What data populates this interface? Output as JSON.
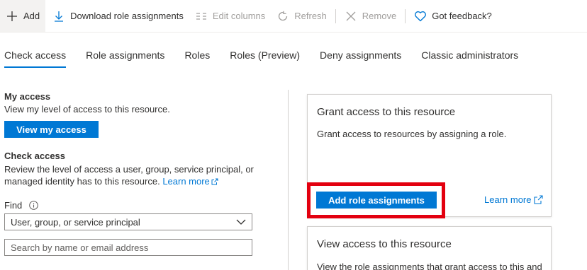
{
  "toolbar": {
    "add_label": "Add",
    "download_label": "Download role assignments",
    "edit_columns_label": "Edit columns",
    "refresh_label": "Refresh",
    "remove_label": "Remove",
    "feedback_label": "Got feedback?"
  },
  "tabs": [
    {
      "label": "Check access",
      "active": true
    },
    {
      "label": "Role assignments",
      "active": false
    },
    {
      "label": "Roles",
      "active": false
    },
    {
      "label": "Roles (Preview)",
      "active": false
    },
    {
      "label": "Deny assignments",
      "active": false
    },
    {
      "label": "Classic administrators",
      "active": false
    }
  ],
  "my_access": {
    "heading": "My access",
    "description": "View my level of access to this resource.",
    "button_label": "View my access"
  },
  "check_access": {
    "heading": "Check access",
    "description_line1": "Review the level of access a user, group, service principal, or",
    "description_line2": "managed identity has to this resource.",
    "learn_more": "Learn more",
    "find_label": "Find",
    "dropdown_value": "User, group, or service principal",
    "search_placeholder": "Search by name or email address"
  },
  "grant_card": {
    "title": "Grant access to this resource",
    "description": "Grant access to resources by assigning a role.",
    "button_label": "Add role assignments",
    "learn_more": "Learn more"
  },
  "view_card": {
    "title": "View access to this resource",
    "description": "View the role assignments that grant access to this and"
  },
  "colors": {
    "accent": "#0078d4",
    "highlight": "#e3000f"
  }
}
